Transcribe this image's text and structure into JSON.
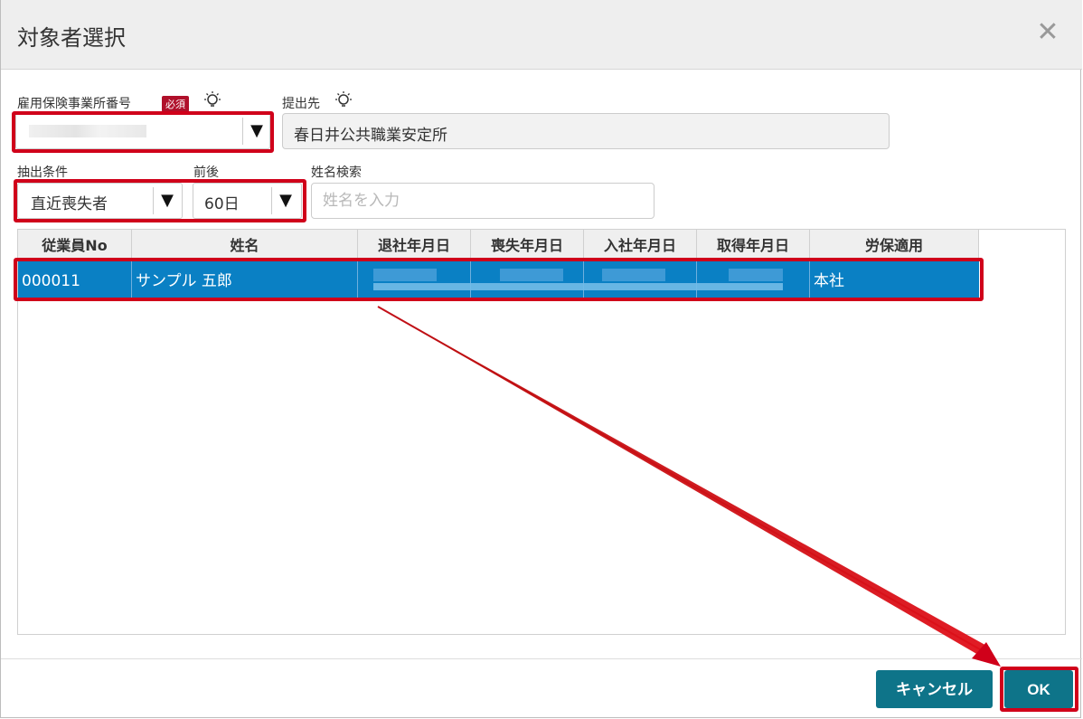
{
  "dialog": {
    "title": "対象者選択",
    "close_icon": "close-icon"
  },
  "form": {
    "office_number_label": "雇用保険事業所番号",
    "required_badge": "必須",
    "submit_to_label": "提出先",
    "submit_to_value": "春日井公共職業安定所",
    "extract_condition_label": "抽出条件",
    "extract_condition_value": "直近喪失者",
    "range_label": "前後",
    "range_value": "60日",
    "name_search_label": "姓名検索",
    "name_search_placeholder": "姓名を入力",
    "dropdown_glyph": "▼"
  },
  "table": {
    "columns": [
      "従業員No",
      "姓名",
      "退社年月日",
      "喪失年月日",
      "入社年月日",
      "取得年月日",
      "労保適用"
    ],
    "rows": [
      {
        "employee_no": "000011",
        "name": "サンプル 五郎",
        "retire_date": "",
        "loss_date": "",
        "join_date": "",
        "acquire_date": "",
        "labor_insurance": "本社"
      }
    ]
  },
  "buttons": {
    "cancel": "キャンセル",
    "ok": "OK"
  },
  "colors": {
    "accent_teal": "#0e7489",
    "selected_row": "#0a80c4",
    "highlight_red": "#d0001a",
    "required_badge": "#b0102a"
  }
}
